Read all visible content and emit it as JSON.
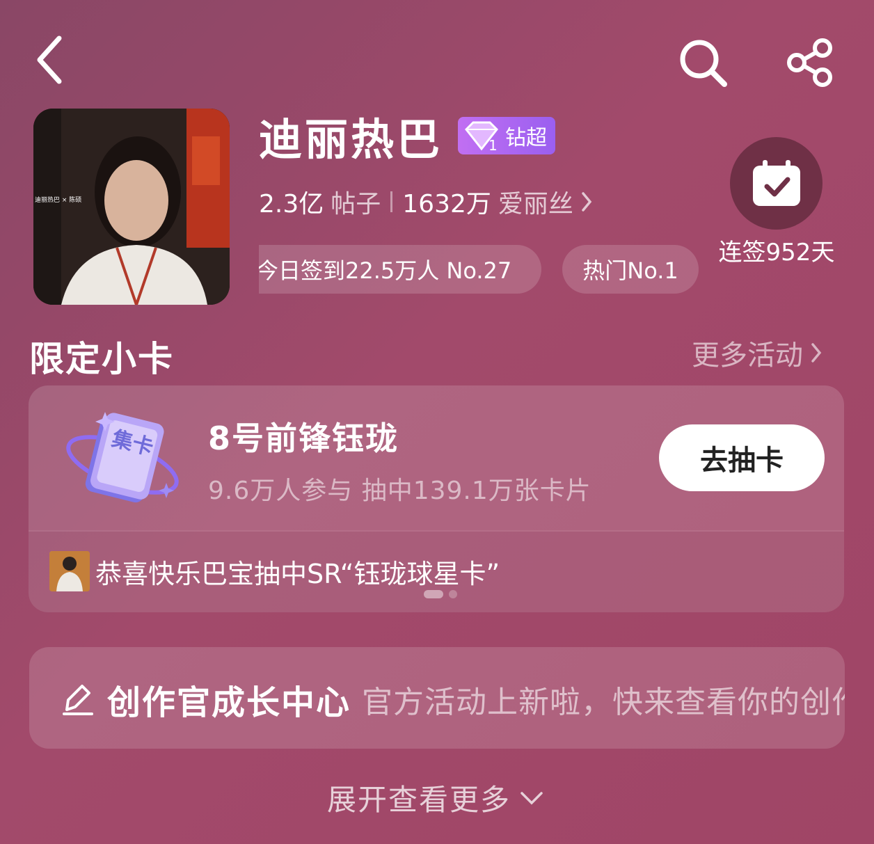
{
  "header": {
    "title": "迪丽热巴",
    "badge_text": "钻超",
    "badge_level": "1",
    "posts_count": "2.3亿",
    "posts_label": "帖子",
    "fans_count": "1632万",
    "fans_label": "爱丽丝",
    "checkin_rank": "今日签到22.5万人 No.27",
    "hot_rank": "热门No.1",
    "streak_label": "连签952天"
  },
  "avatar": {
    "overlay_text": "迪丽热巴 × 陈硕"
  },
  "limited_cards": {
    "section_title": "限定小卡",
    "more_label": "更多活动",
    "illus_label": "集卡",
    "card_name": "8号前锋钰珑",
    "card_stats": "9.6万人参与 抽中139.1万张卡片",
    "draw_button": "去抽卡",
    "winner_text": "恭喜快乐巴宝抽中SR“钰珑球星卡”",
    "page_index": 0,
    "page_count": 2
  },
  "creator": {
    "title": "创作官成长中心",
    "desc": "官方活动上新啦，快来查看你的创作"
  },
  "expand_label": "展开查看更多",
  "colors": {
    "background": "#9b4868",
    "badge": "#b56ef2",
    "checkin_circle": "#6f3046"
  }
}
